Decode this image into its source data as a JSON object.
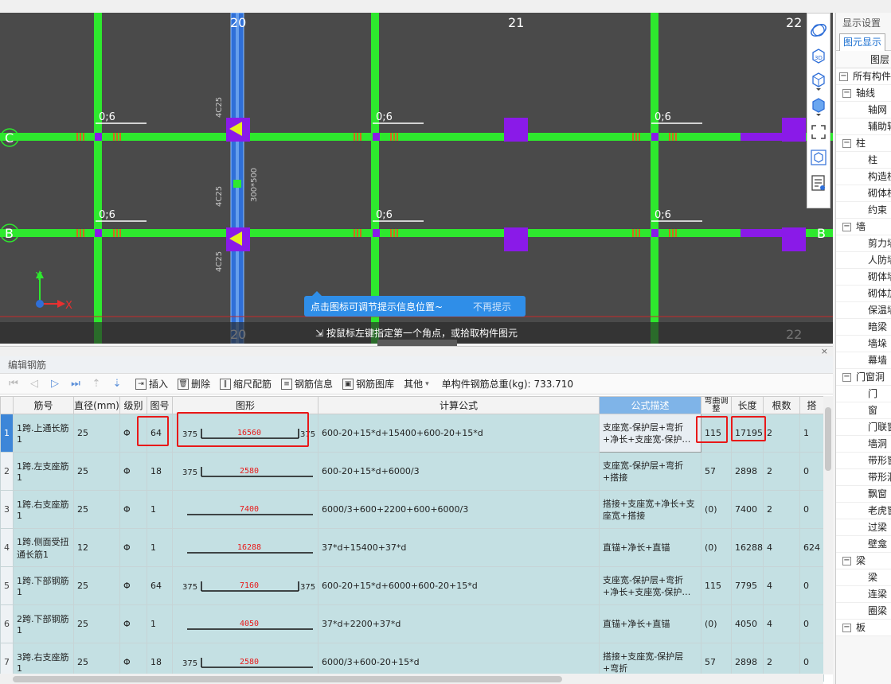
{
  "canvas": {
    "axes_top": [
      "20",
      "21",
      "22"
    ],
    "axes_side": [
      "C",
      "B"
    ],
    "beam_annotations": [
      "0;6",
      "0;6",
      "0;6",
      "0;6",
      "0;6",
      "0;6"
    ],
    "rebar_dims": [
      "4C25",
      "4C25",
      "4C25",
      "300*500"
    ],
    "coord_y": "Y",
    "coord_x": "X",
    "hint_text": "点击图标可调节提示信息位置~",
    "hint_dismiss": "不再提示",
    "status_text": "按鼠标左键指定第一个角点，或拾取构件图元",
    "colors": {
      "grid": "#2ee82e",
      "column": "#8a1ae8",
      "selected_beam": "#2f6fd8"
    }
  },
  "right_panel": {
    "title": "显示设置",
    "tab": "图元显示",
    "header": "图层",
    "items": [
      {
        "label": "所有构件",
        "level": 0,
        "expand": "−"
      },
      {
        "label": "轴线",
        "level": 1,
        "expand": "−"
      },
      {
        "label": "轴网",
        "level": 2
      },
      {
        "label": "辅助轴",
        "level": 2
      },
      {
        "label": "柱",
        "level": 1,
        "expand": "−"
      },
      {
        "label": "柱",
        "level": 2
      },
      {
        "label": "构造柱",
        "level": 2
      },
      {
        "label": "砌体柱",
        "level": 2
      },
      {
        "label": "约束",
        "level": 2
      },
      {
        "label": "墙",
        "level": 1,
        "expand": "−"
      },
      {
        "label": "剪力墙",
        "level": 2
      },
      {
        "label": "人防墙",
        "level": 2
      },
      {
        "label": "砌体墙",
        "level": 2
      },
      {
        "label": "砌体加",
        "level": 2
      },
      {
        "label": "保温墙",
        "level": 2
      },
      {
        "label": "暗梁",
        "level": 2
      },
      {
        "label": "墙垛",
        "level": 2
      },
      {
        "label": "幕墙",
        "level": 2
      },
      {
        "label": "门窗洞",
        "level": 1,
        "expand": "−"
      },
      {
        "label": "门",
        "level": 2
      },
      {
        "label": "窗",
        "level": 2
      },
      {
        "label": "门联窗",
        "level": 2
      },
      {
        "label": "墙洞",
        "level": 2
      },
      {
        "label": "带形窗",
        "level": 2
      },
      {
        "label": "带形洞",
        "level": 2
      },
      {
        "label": "飘窗",
        "level": 2
      },
      {
        "label": "老虎窗",
        "level": 2
      },
      {
        "label": "过梁",
        "level": 2
      },
      {
        "label": "壁龛",
        "level": 2
      },
      {
        "label": "梁",
        "level": 1,
        "expand": "−"
      },
      {
        "label": "梁",
        "level": 2
      },
      {
        "label": "连梁",
        "level": 2
      },
      {
        "label": "圈梁",
        "level": 2
      },
      {
        "label": "板",
        "level": 1,
        "expand": "−"
      }
    ]
  },
  "rebar_panel": {
    "title": "编辑钢筋",
    "close": "×",
    "toolbar": {
      "insert": "插入",
      "delete": "删除",
      "scale_rebar": "缩尺配筋",
      "rebar_info": "钢筋信息",
      "rebar_library": "钢筋图库",
      "other": "其他",
      "total_weight_label": "单构件钢筋总重(kg):",
      "total_weight_value": "733.710"
    },
    "columns": [
      "筋号",
      "直径(mm)",
      "级别",
      "图号",
      "图形",
      "计算公式",
      "公式描述",
      "弯曲调整",
      "长度",
      "根数",
      "搭"
    ],
    "rows": [
      {
        "idx": "1",
        "name": "1跨.上通长筋1",
        "dia": "25",
        "grade": "Φ",
        "fig": "64",
        "shape_left": "375",
        "shape_len": "16560",
        "shape_right": "375",
        "formula": "600-20+15*d+15400+600-20+15*d",
        "desc": "支座宽-保护层+弯折+净长+支座宽-保护…",
        "bend": "115",
        "length": "17195",
        "count": "2",
        "lap": "1"
      },
      {
        "idx": "2",
        "name": "1跨.左支座筋1",
        "dia": "25",
        "grade": "Φ",
        "fig": "18",
        "shape_left": "375",
        "shape_len": "2580",
        "shape_right": "",
        "formula": "600-20+15*d+6000/3",
        "desc": "支座宽-保护层+弯折+搭接",
        "bend": "57",
        "length": "2898",
        "count": "2",
        "lap": "0"
      },
      {
        "idx": "3",
        "name": "1跨.右支座筋1",
        "dia": "25",
        "grade": "Φ",
        "fig": "1",
        "shape_left": "",
        "shape_len": "7400",
        "shape_right": "",
        "formula": "6000/3+600+2200+600+6000/3",
        "desc": "搭接+支座宽+净长+支座宽+搭接",
        "bend": "(0)",
        "length": "7400",
        "count": "2",
        "lap": "0"
      },
      {
        "idx": "4",
        "name": "1跨.侧面受扭通长筋1",
        "dia": "12",
        "grade": "Φ",
        "fig": "1",
        "shape_left": "",
        "shape_len": "16288",
        "shape_right": "",
        "formula": "37*d+15400+37*d",
        "desc": "直锚+净长+直锚",
        "bend": "(0)",
        "length": "16288",
        "count": "4",
        "lap": "624"
      },
      {
        "idx": "5",
        "name": "1跨.下部钢筋1",
        "dia": "25",
        "grade": "Φ",
        "fig": "64",
        "shape_left": "375",
        "shape_len": "7160",
        "shape_right": "375",
        "formula": "600-20+15*d+6000+600-20+15*d",
        "desc": "支座宽-保护层+弯折+净长+支座宽-保护…",
        "bend": "115",
        "length": "7795",
        "count": "4",
        "lap": "0"
      },
      {
        "idx": "6",
        "name": "2跨.下部钢筋1",
        "dia": "25",
        "grade": "Φ",
        "fig": "1",
        "shape_left": "",
        "shape_len": "4050",
        "shape_right": "",
        "formula": "37*d+2200+37*d",
        "desc": "直锚+净长+直锚",
        "bend": "(0)",
        "length": "4050",
        "count": "4",
        "lap": "0"
      },
      {
        "idx": "7",
        "name": "3跨.右支座筋1",
        "dia": "25",
        "grade": "Φ",
        "fig": "18",
        "shape_left": "375",
        "shape_len": "2580",
        "shape_right": "",
        "formula": "6000/3+600-20+15*d",
        "desc": "搭接+支座宽-保护层+弯折",
        "bend": "57",
        "length": "2898",
        "count": "2",
        "lap": "0"
      }
    ],
    "highlight_color": "#e81919"
  }
}
